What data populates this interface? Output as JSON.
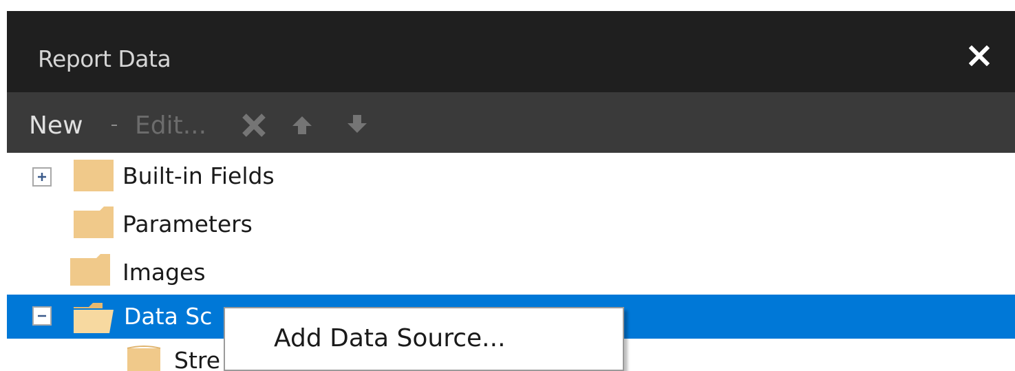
{
  "panel": {
    "title": "Report Data"
  },
  "toolbar": {
    "new_label": "New",
    "edit_label": "Edit...",
    "icons": [
      "delete-icon",
      "move-up-icon",
      "move-down-icon"
    ]
  },
  "tree": {
    "items": [
      {
        "label": "Built-in Fields",
        "expander": "plus",
        "selected": false
      },
      {
        "label": "Parameters",
        "expander": "none",
        "selected": false
      },
      {
        "label": "Images",
        "expander": "none",
        "selected": false
      },
      {
        "label": "Data Sc",
        "expander": "minus",
        "selected": true
      }
    ],
    "child_label": "Stre"
  },
  "context_menu": {
    "items": [
      {
        "label": "Add Data Source..."
      }
    ]
  },
  "colors": {
    "title_bar": "#1f1f1f",
    "toolbar": "#3a3a3a",
    "selection": "#0078d7",
    "folder": "#f0c98a"
  }
}
